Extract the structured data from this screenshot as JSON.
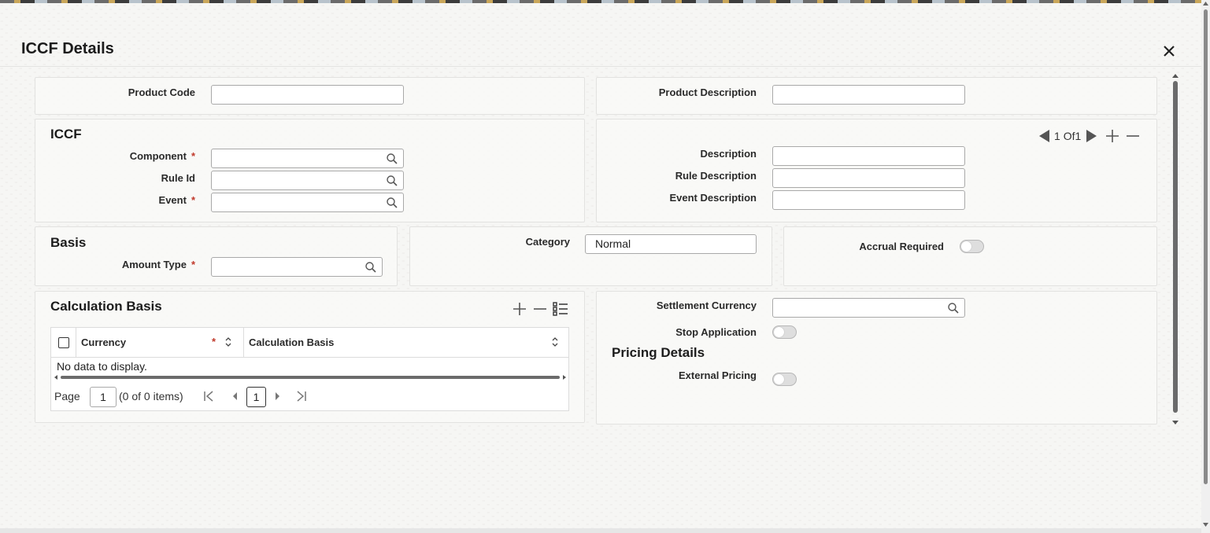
{
  "dialog": {
    "title": "ICCF Details",
    "close_label": "✕"
  },
  "header": {
    "product_code_label": "Product Code",
    "product_code_value": "",
    "product_description_label": "Product Description",
    "product_description_value": ""
  },
  "iccf": {
    "title": "ICCF",
    "component_label": "Component",
    "rule_id_label": "Rule Id",
    "event_label": "Event",
    "required_mark": "*",
    "navigator": {
      "current": "1",
      "of_label": "Of",
      "total": "1"
    },
    "description_label": "Description",
    "rule_description_label": "Rule Description",
    "event_description_label": "Event Description"
  },
  "basis": {
    "title": "Basis",
    "amount_type_label": "Amount Type",
    "category_label": "Category",
    "category_value": "Normal",
    "accrual_required_label": "Accrual Required"
  },
  "calculation_basis": {
    "title": "Calculation Basis",
    "columns": [
      "Currency",
      "Calculation Basis"
    ],
    "empty_text": "No data to display.",
    "pager": {
      "page_label": "Page",
      "page_value": "1",
      "items_text": "(0 of 0 items)",
      "current_page": "1"
    }
  },
  "settlement": {
    "settlement_currency_label": "Settlement Currency",
    "stop_application_label": "Stop Application",
    "pricing_title": "Pricing Details",
    "external_pricing_label": "External Pricing"
  },
  "colors": {
    "required": "#c0392b",
    "panel_border": "#e2e2e0",
    "field_border": "#a9a9a9"
  }
}
